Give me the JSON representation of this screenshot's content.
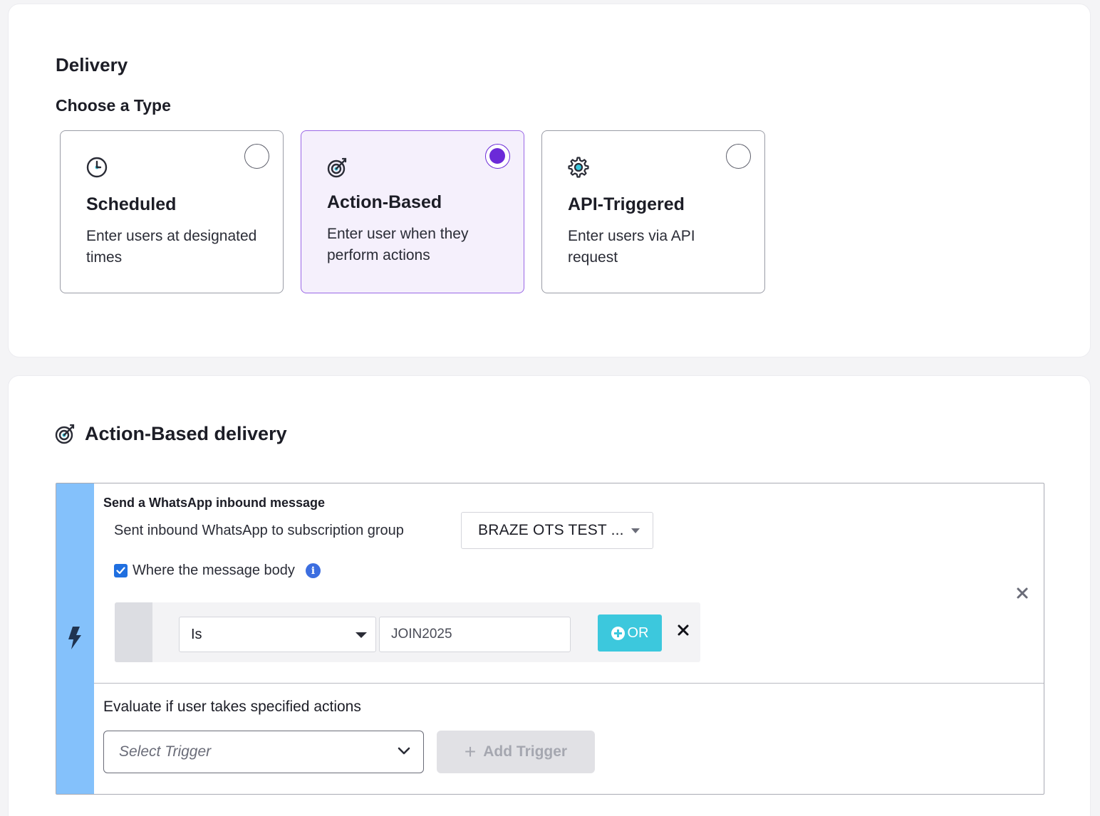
{
  "delivery": {
    "title": "Delivery",
    "choose_label": "Choose a Type",
    "types": [
      {
        "title": "Scheduled",
        "description": "Enter users at designated times",
        "icon": "clock-icon",
        "selected": false
      },
      {
        "title": "Action-Based",
        "description": "Enter user when they perform actions",
        "icon": "target-icon",
        "selected": true
      },
      {
        "title": "API-Triggered",
        "description": "Enter users via API request",
        "icon": "gear-icon",
        "selected": false
      }
    ]
  },
  "action_delivery": {
    "title": "Action-Based delivery",
    "icon": "target-icon",
    "trigger": {
      "title": "Send a WhatsApp inbound message",
      "subscription_label": "Sent inbound WhatsApp to subscription group",
      "subscription_value": "BRAZE OTS TEST ...",
      "where_checked": true,
      "where_label": "Where the message body",
      "filter": {
        "operator": "Is",
        "value": "JOIN2025",
        "or_label": "OR"
      }
    },
    "evaluate_label": "Evaluate if user takes specified actions",
    "select_trigger_placeholder": "Select Trigger",
    "add_trigger_label": "Add Trigger"
  },
  "colors": {
    "accent": "#6b2ad8",
    "strip": "#84c1fb",
    "or_button": "#3cc8dd",
    "checkbox": "#1f6fe0"
  }
}
